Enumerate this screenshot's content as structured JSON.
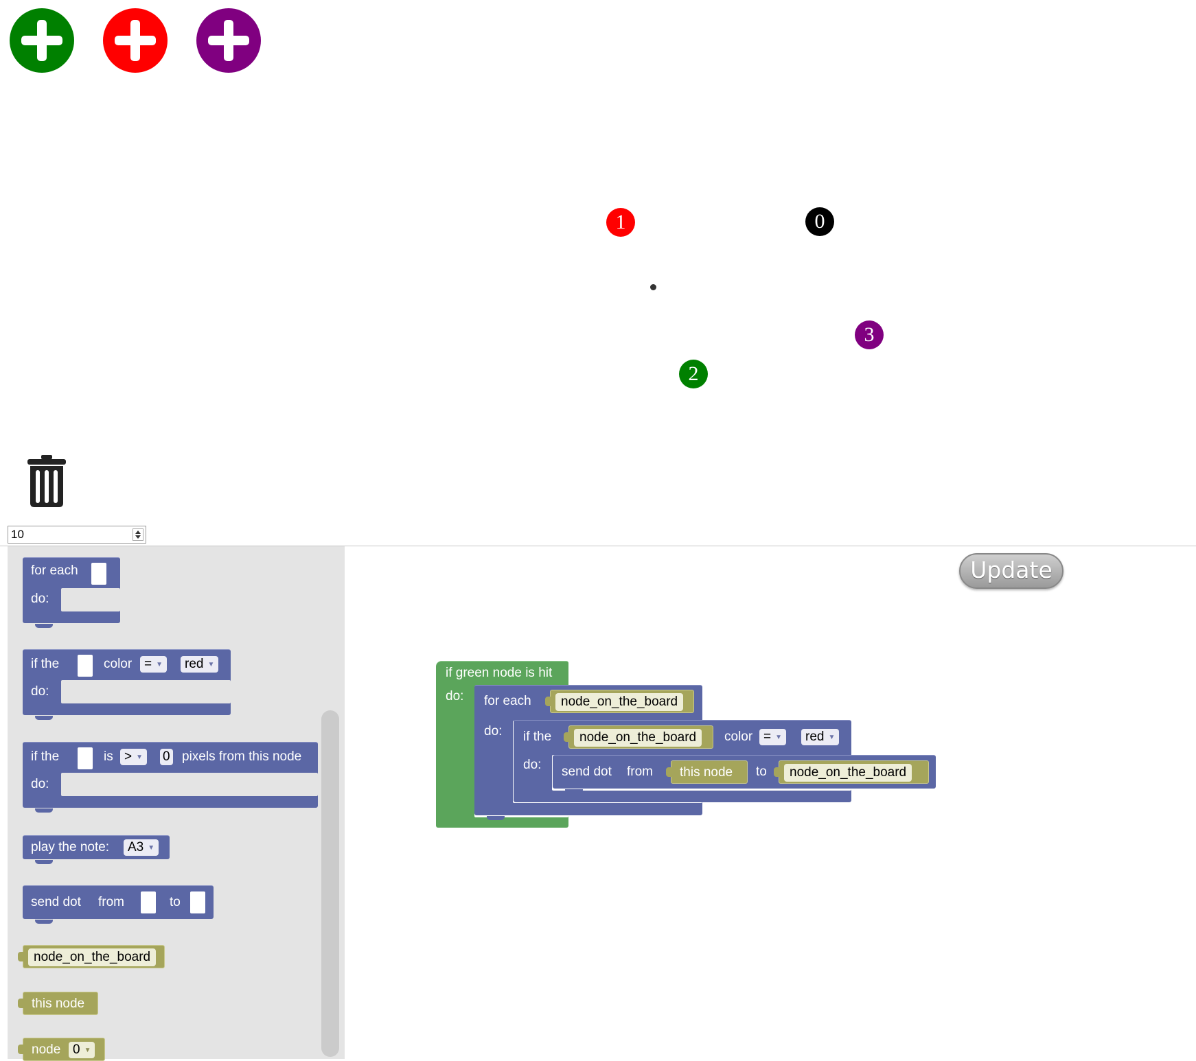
{
  "top_buttons": [
    {
      "name": "add-green-node-button",
      "color": "#008000"
    },
    {
      "name": "add-red-node-button",
      "color": "#ff0000"
    },
    {
      "name": "add-purple-node-button",
      "color": "#800080"
    }
  ],
  "board": {
    "nodes": [
      {
        "label": "1",
        "color": "#ff0000"
      },
      {
        "label": "0",
        "color": "#000000"
      },
      {
        "label": "3",
        "color": "#800080"
      },
      {
        "label": "2",
        "color": "#008000"
      }
    ]
  },
  "speed_input": {
    "value": "10"
  },
  "update_button": {
    "label": "Update"
  },
  "toolbox": {
    "for_each": {
      "label": "for each",
      "do": "do:"
    },
    "if_color": {
      "label": "if the",
      "color": "color",
      "op": "=",
      "value": "red",
      "do": "do:"
    },
    "if_distance": {
      "label": "if the",
      "is": "is",
      "op": ">",
      "num": "0",
      "suffix": "pixels from this node",
      "do": "do:"
    },
    "play_note": {
      "label": "play the note:",
      "note": "A3"
    },
    "send_dot": {
      "label": "send dot",
      "from": "from",
      "to": "to"
    },
    "node_on_board": {
      "label": "node_on_the_board"
    },
    "this_node": {
      "label": "this node"
    },
    "node_n": {
      "label": "node",
      "value": "0"
    }
  },
  "workspace": {
    "event": {
      "label": "if green node is hit",
      "do": "do:"
    },
    "for_each": {
      "label": "for each",
      "var": "node_on_the_board",
      "do": "do:"
    },
    "if_color": {
      "label": "if the",
      "var": "node_on_the_board",
      "color": "color",
      "op": "=",
      "value": "red",
      "do": "do:"
    },
    "send_dot": {
      "label": "send dot",
      "from": "from",
      "from_value": "this node",
      "to": "to",
      "to_value": "node_on_the_board"
    }
  }
}
